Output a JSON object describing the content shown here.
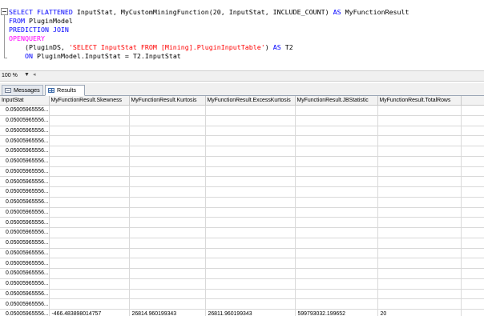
{
  "editor": {
    "lines": [
      [
        [
          "kw",
          "SELECT FLATTENED "
        ],
        [
          "txt",
          "InputStat, MyCustomMiningFunction(20, InputStat, INCLUDE_COUNT) "
        ],
        [
          "kw",
          "AS"
        ],
        [
          "txt",
          " MyFunctionResult"
        ]
      ],
      [
        [
          "kw",
          "FROM "
        ],
        [
          "txt",
          "PluginModel"
        ]
      ],
      [
        [
          "kw",
          "PREDICTION JOIN"
        ]
      ],
      [
        [
          "fn",
          "OPENQUERY"
        ]
      ],
      [
        [
          "txt",
          "    (PluginDS, "
        ],
        [
          "str",
          "'SELECT InputStat FROM [Mining].PluginInputTable'"
        ],
        [
          "txt",
          ") "
        ],
        [
          "kw",
          "AS"
        ],
        [
          "txt",
          " T2"
        ]
      ],
      [
        [
          "txt",
          "    "
        ],
        [
          "kw",
          "ON"
        ],
        [
          "txt",
          " PluginModel.InputStat = T2.InputStat"
        ]
      ]
    ]
  },
  "zoom": {
    "value": "100 %"
  },
  "tabs": {
    "messages": "Messages",
    "results": "Results"
  },
  "grid": {
    "columns": [
      "InputStat",
      "MyFunctionResult.Skewness",
      "MyFunctionResult.Kurtosis",
      "MyFunctionResult.ExcessKurtosis",
      "MyFunctionResult.JBStatistic",
      "MyFunctionResult.TotalRows"
    ],
    "rows": [
      [
        "0.05005965556...",
        "",
        "",
        "",
        "",
        ""
      ],
      [
        "0.05005965556...",
        "",
        "",
        "",
        "",
        ""
      ],
      [
        "0.05005965556...",
        "",
        "",
        "",
        "",
        ""
      ],
      [
        "0.05005965556...",
        "",
        "",
        "",
        "",
        ""
      ],
      [
        "0.05005965556...",
        "",
        "",
        "",
        "",
        ""
      ],
      [
        "0.05005965556...",
        "",
        "",
        "",
        "",
        ""
      ],
      [
        "0.05005965556...",
        "",
        "",
        "",
        "",
        ""
      ],
      [
        "0.05005965556...",
        "",
        "",
        "",
        "",
        ""
      ],
      [
        "0.05005965556...",
        "",
        "",
        "",
        "",
        ""
      ],
      [
        "0.05005965556...",
        "",
        "",
        "",
        "",
        ""
      ],
      [
        "0.05005965556...",
        "",
        "",
        "",
        "",
        ""
      ],
      [
        "0.05005965556...",
        "",
        "",
        "",
        "",
        ""
      ],
      [
        "0.05005965556...",
        "",
        "",
        "",
        "",
        ""
      ],
      [
        "0.05005965556...",
        "",
        "",
        "",
        "",
        ""
      ],
      [
        "0.05005965556...",
        "",
        "",
        "",
        "",
        ""
      ],
      [
        "0.05005965556...",
        "",
        "",
        "",
        "",
        ""
      ],
      [
        "0.05005965556...",
        "",
        "",
        "",
        "",
        ""
      ],
      [
        "0.05005965556...",
        "",
        "",
        "",
        "",
        ""
      ],
      [
        "0.05005965556...",
        "",
        "",
        "",
        "",
        ""
      ],
      [
        "0.05005965556...",
        "",
        "",
        "",
        "",
        ""
      ],
      [
        "0.05005965556...",
        "-466.483898014757",
        "26814.960199343",
        "26811.960199343",
        "599793032.199652",
        "20"
      ]
    ]
  }
}
